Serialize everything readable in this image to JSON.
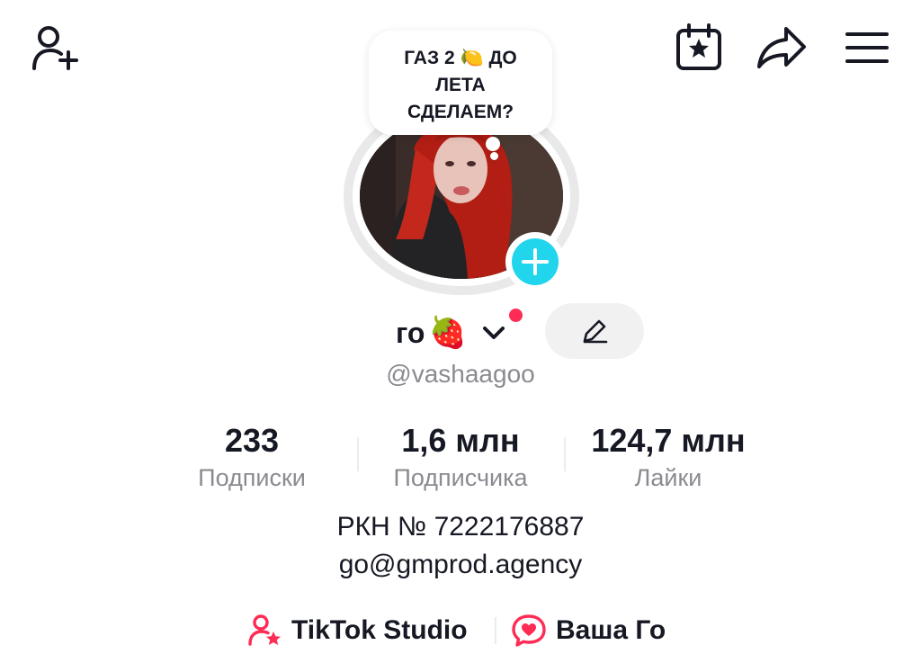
{
  "header": {
    "add_friend_icon": "person-plus-icon",
    "calendar_icon": "calendar-star-icon",
    "share_icon": "share-arrow-icon",
    "menu_icon": "hamburger-menu-icon"
  },
  "note": {
    "line1_before": "ГАЗ 2 ",
    "line1_emoji": "🍋",
    "line1_after": " ДО",
    "line2": "ЛЕТА",
    "line3": "СДЕЛАЕМ?"
  },
  "profile": {
    "display_name": "го",
    "name_emoji": "🍓",
    "username": "@vashaagoo",
    "accent_color": "#fe2c55",
    "avatar_add_color": "#20d5ec"
  },
  "stats": [
    {
      "value": "233",
      "label": "Подписки"
    },
    {
      "value": "1,6 млн",
      "label": "Подписчика"
    },
    {
      "value": "124,7 млн",
      "label": "Лайки"
    }
  ],
  "bio": {
    "line1": "РКН  № 7222176887",
    "line2": "go@gmprod.agency"
  },
  "links": [
    {
      "label": "TikTok Studio",
      "icon": "person-star-icon"
    },
    {
      "label": "Ваша Го",
      "icon": "chat-heart-icon"
    }
  ]
}
